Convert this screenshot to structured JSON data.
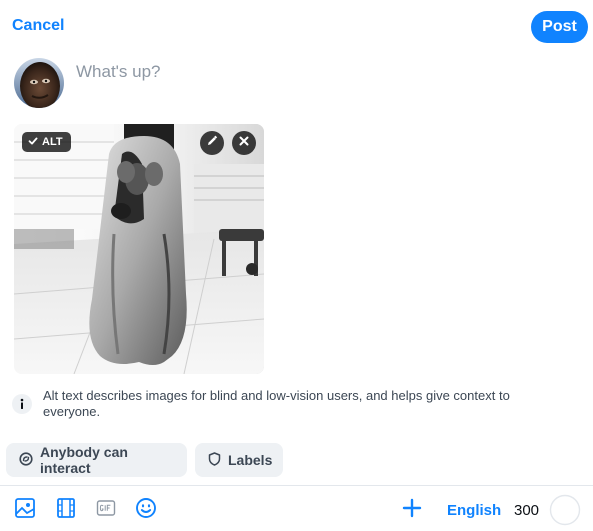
{
  "header": {
    "cancel_label": "Cancel",
    "post_label": "Post"
  },
  "composer": {
    "placeholder": "What's up?",
    "value": ""
  },
  "media": {
    "alt_badge_label": "ALT",
    "icons": [
      "check-icon",
      "pencil-icon",
      "close-icon"
    ]
  },
  "info": {
    "text": "Alt text describes images for blind and low-vision users, and helps give context to everyone."
  },
  "chips": {
    "interaction_label": "Anybody can interact",
    "labels_label": "Labels"
  },
  "toolbar": {
    "language": "English",
    "char_count": "300",
    "char_progress": 0,
    "icons": [
      "image-icon",
      "video-icon",
      "gif-icon",
      "emoji-icon",
      "plus-icon"
    ]
  },
  "colors": {
    "accent": "#1083fe",
    "chip_background": "#eef1f4",
    "text_muted": "#3c4754"
  }
}
